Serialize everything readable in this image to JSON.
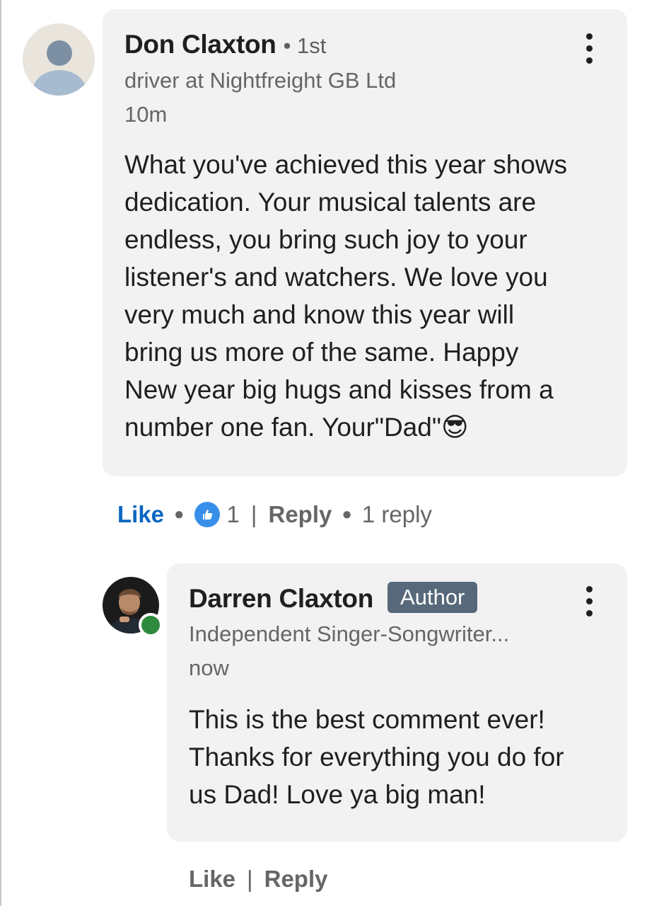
{
  "comment": {
    "author": "Don Claxton",
    "degree": "• 1st",
    "headline": "driver at Nightfreight GB Ltd",
    "time": "10m",
    "text": "What you've achieved this year shows\ndedication.  Your musical talents are\nendless, you bring such joy to your\nlistener's and watchers. We love you\nvery much and know this year will\nbring us more of the same. Happy\nNew year big hugs and kisses from a\nnumber one fan. Your\"Dad\"😎",
    "actions": {
      "like_label": "Like",
      "reaction_count": "1",
      "reply_label": "Reply",
      "replies_count": "1 reply"
    }
  },
  "reply": {
    "author": "Darren Claxton",
    "badge": "Author",
    "headline": "Independent Singer-Songwriter...",
    "time": "now",
    "text": "This is the best comment ever!\nThanks for everything you do for\nus Dad! Love ya big man!",
    "actions": {
      "like_label": "Like",
      "reply_label": "Reply"
    }
  },
  "colors": {
    "like_blue": "#0a66c2",
    "author_badge": "#56687a",
    "online_green": "#2e8b3e",
    "bubble": "#f2f2f2"
  },
  "icons": [
    "default-avatar-icon",
    "more-options-icon",
    "like-reaction-icon",
    "online-status-icon"
  ]
}
